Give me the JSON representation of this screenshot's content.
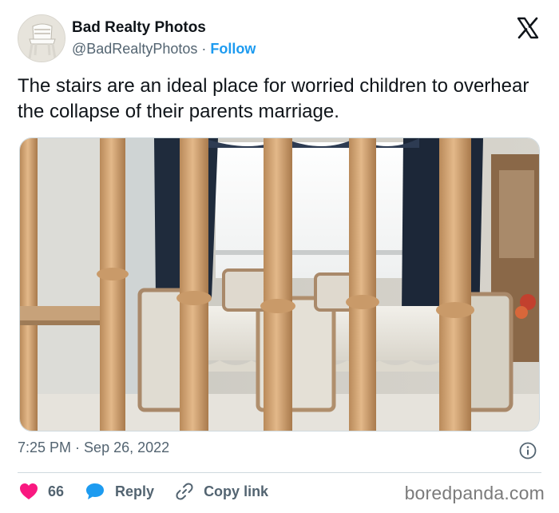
{
  "account": {
    "display_name": "Bad Realty Photos",
    "handle": "@BadRealtyPhotos",
    "separator": "·",
    "follow_label": "Follow"
  },
  "tweet": {
    "text": "The stairs are an ideal place for worried children to overhear the collapse of their parents marriage.",
    "time": "7:25 PM",
    "date": "Sep 26, 2022"
  },
  "actions": {
    "like_count": "66",
    "reply_label": "Reply",
    "copy_link_label": "Copy link"
  },
  "watermark": "boredpanda.com",
  "colors": {
    "link_blue": "#1d9bf0",
    "heart_pink": "#f91880",
    "muted_text": "#536471"
  },
  "icons": [
    "x-logo-icon",
    "info-icon",
    "heart-icon",
    "reply-bubble-icon",
    "link-icon"
  ]
}
